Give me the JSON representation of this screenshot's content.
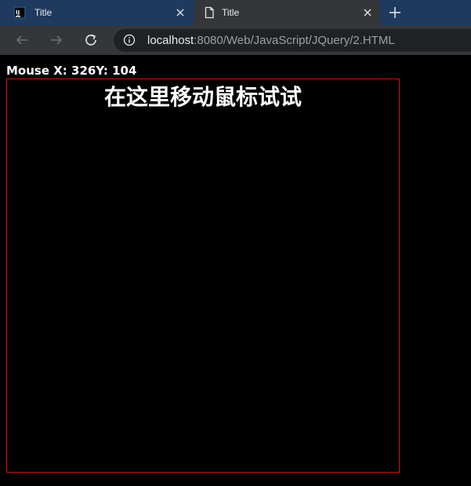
{
  "browser": {
    "tabs": [
      {
        "title": "Title",
        "favicon": "intellij-icon",
        "active": false
      },
      {
        "title": "Title",
        "favicon": "document-icon",
        "active": true
      }
    ],
    "new_tab_icon": "plus-icon",
    "toolbar": {
      "back_icon": "arrow-left-icon",
      "forward_icon": "arrow-right-icon",
      "reload_icon": "reload-icon",
      "info_icon": "info-icon",
      "url_host": "localhost",
      "url_rest": ":8080/Web/JavaScript/JQuery/2.HTML"
    },
    "colors": {
      "tabstrip": "#1f3a5f",
      "toolbar": "#35363a",
      "omnibox": "#202124"
    }
  },
  "page": {
    "mouse_readout": "Mouse X: 326Y: 104",
    "box_title": "在这里移动鼠标试试",
    "colors": {
      "background": "#000000",
      "box_border": "#d01010",
      "text": "#ffffff"
    }
  }
}
